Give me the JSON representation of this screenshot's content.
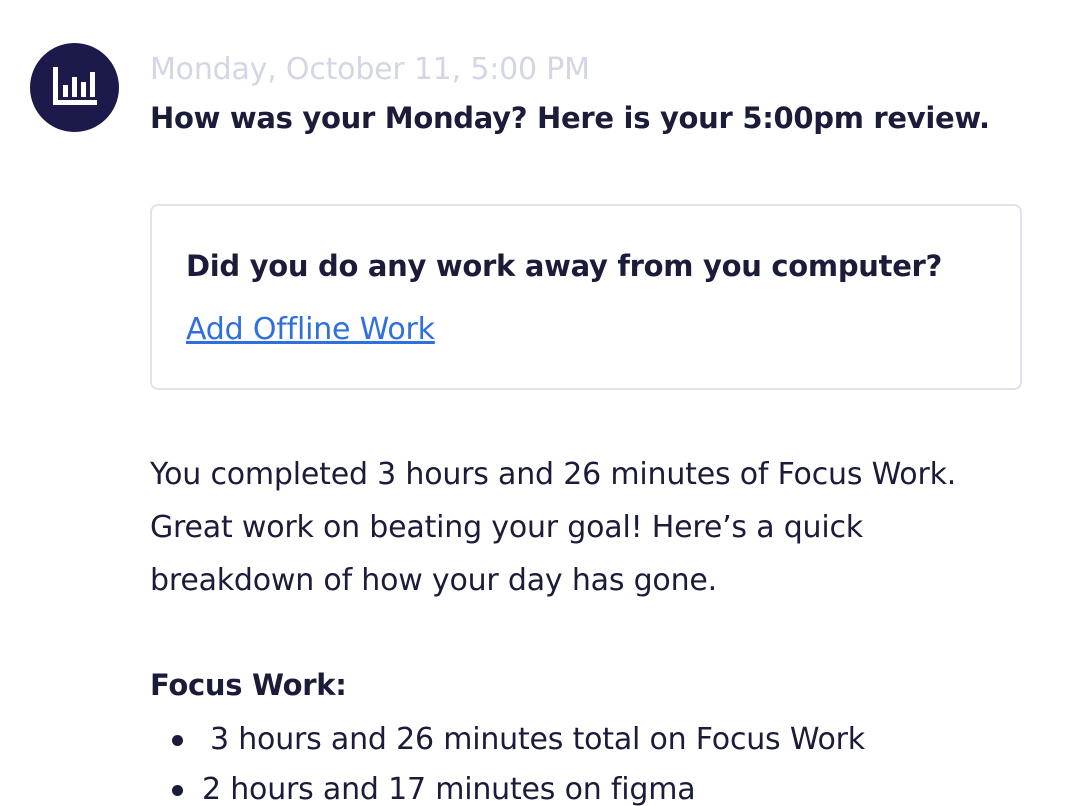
{
  "message": {
    "avatar_icon": "bar-chart-icon",
    "timestamp": "Monday, October 11, 5:00 PM",
    "headline": "How was your Monday? Here is your 5:00pm review.",
    "offline_card": {
      "question": "Did you do any work away from you computer?",
      "link_label": "Add Offline Work"
    },
    "summary": "You completed 3 hours and 26 minutes of Focus Work. Great work on beating your goal! Here’s a quick breakdown of how your day has gone.",
    "focus_section": {
      "title": "Focus Work:",
      "items": [
        " 3 hours and 26 minutes total on Focus Work",
        "2 hours and 17 minutes on figma"
      ]
    }
  },
  "colors": {
    "avatar_bg": "#1c1a4a",
    "text": "#1b1b3a",
    "timestamp": "#d3d6e4",
    "link": "#2f6fdf",
    "card_border": "#e1e2ea"
  }
}
